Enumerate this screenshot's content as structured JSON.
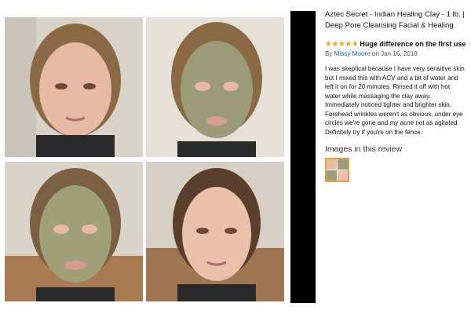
{
  "product": {
    "title_line1": "Aztec Secret - Indian Healing Clay - 1 lb. |",
    "title_line2": "Deep Pore Cleansing Facial & Healing"
  },
  "review": {
    "rating": 5,
    "stars": "★★★★★",
    "headline": "Huge difference on the first use",
    "by_prefix": "By",
    "author": "Missy Moore",
    "date": "on Jan 16, 2018",
    "body": "I was skeptical because I have very sensitive skin but I mixed this with ACV and a bit of water and left it on for 20 minutes. Rinsed it off with hot water while massaging the clay away. Immediately noticed tighter and brighter skin. Forehead wrinkles weren't as obvious, under eye circles we're gone and my acne not as agitated. Definitely try if you're on the fence."
  },
  "images_section": {
    "heading": "Images in this review"
  },
  "colors": {
    "star": "#f4a41a",
    "link": "#0066c0",
    "skin": "#e8b9a4",
    "clay": "#9a9a78",
    "hair": "#8a6a45"
  }
}
